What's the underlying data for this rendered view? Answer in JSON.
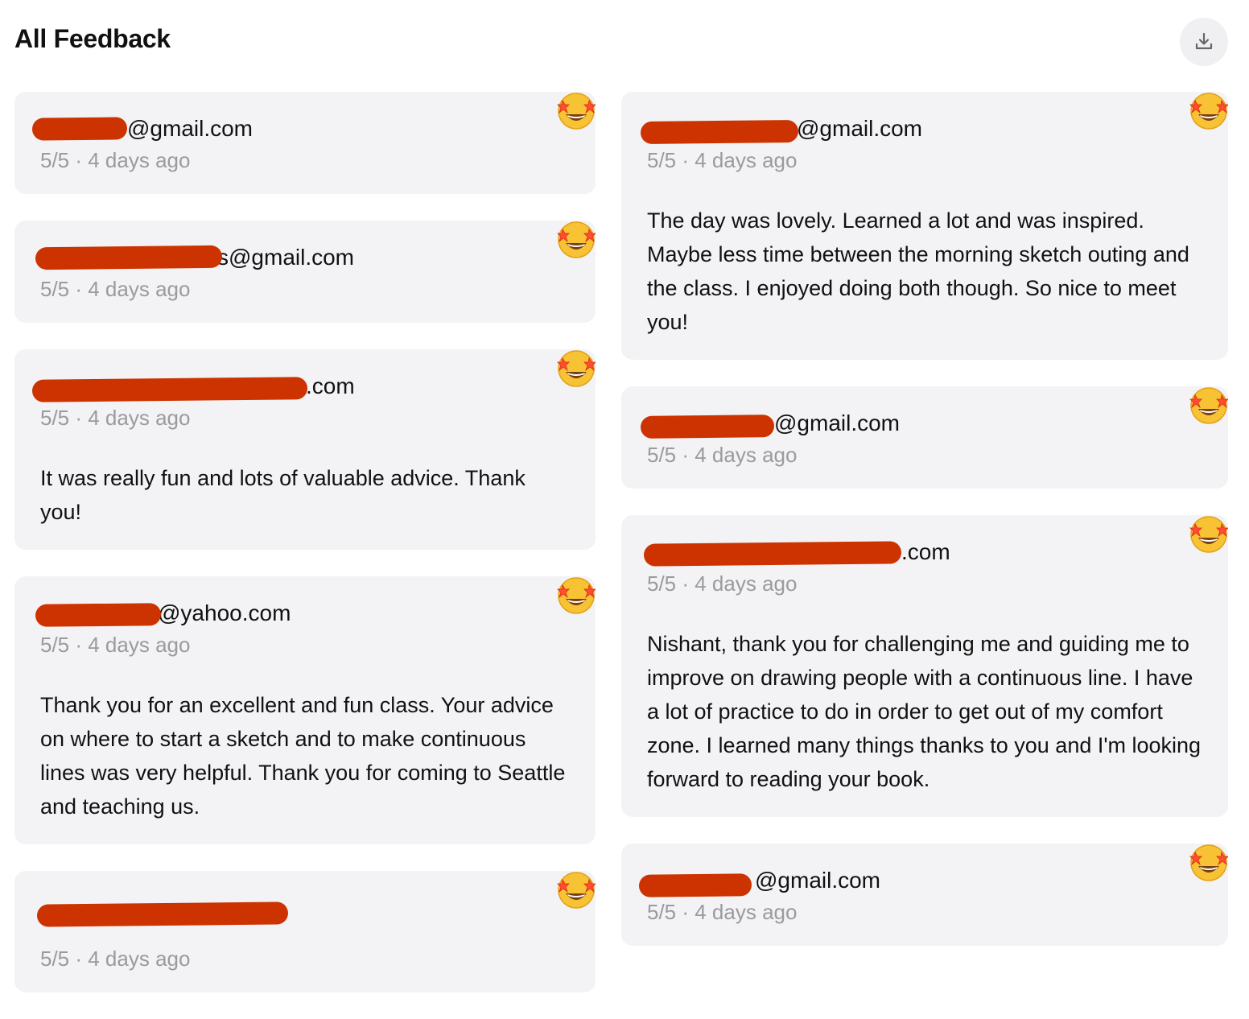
{
  "page": {
    "title": "All Feedback",
    "download_icon": "download-icon"
  },
  "colors": {
    "card_bg": "#f3f3f5",
    "redaction": "#cc3300",
    "meta_text": "#9a9a9f",
    "emoji_face": "#f7c234"
  },
  "left_cards": [
    {
      "email": "@gmail.com",
      "rating": "5/5",
      "time": "4 days ago",
      "meta": "5/5 · 4 days ago",
      "comment": "",
      "emoji_icon": "star-struck-emoji-icon"
    },
    {
      "email": "s@gmail.com",
      "rating": "5/5",
      "time": "4 days ago",
      "meta": "5/5 · 4 days ago",
      "comment": "",
      "emoji_icon": "star-struck-emoji-icon"
    },
    {
      "email": ".com",
      "rating": "5/5",
      "time": "4 days ago",
      "meta": "5/5 · 4 days ago",
      "comment": "It was really fun and lots of valuable advice. Thank you!",
      "emoji_icon": "star-struck-emoji-icon"
    },
    {
      "email": "@yahoo.com",
      "rating": "5/5",
      "time": "4 days ago",
      "meta": "5/5 · 4 days ago",
      "comment": "Thank you for an excellent and fun class. Your advice on where to start a sketch and to make continuous lines was very helpful. Thank you for coming to Seattle and teaching us.",
      "emoji_icon": "star-struck-emoji-icon"
    },
    {
      "email": "",
      "rating": "5/5",
      "time": "4 days ago",
      "meta": "5/5 · 4 days ago",
      "comment": "",
      "emoji_icon": "star-struck-emoji-icon"
    }
  ],
  "right_cards": [
    {
      "email": "@gmail.com",
      "rating": "5/5",
      "time": "4 days ago",
      "meta": "5/5 · 4 days ago",
      "comment": "The day was lovely. Learned a lot and was inspired. Maybe less time between the morning sketch outing and the class. I enjoyed doing both though. So nice to meet you!",
      "emoji_icon": "star-struck-emoji-icon"
    },
    {
      "email": "@gmail.com",
      "rating": "5/5",
      "time": "4 days ago",
      "meta": "5/5 · 4 days ago",
      "comment": "",
      "emoji_icon": "star-struck-emoji-icon"
    },
    {
      "email": ".com",
      "rating": "5/5",
      "time": "4 days ago",
      "meta": "5/5 · 4 days ago",
      "comment": "Nishant, thank you for challenging me and guiding me to improve on drawing people with a continuous line. I have a lot of practice to do in order to get out of my comfort zone. I learned many things thanks to you and I'm looking forward to reading your book.",
      "emoji_icon": "star-struck-emoji-icon"
    },
    {
      "email": "@gmail.com",
      "rating": "5/5",
      "time": "4 days ago",
      "meta": "5/5 · 4 days ago",
      "comment": "",
      "emoji_icon": "star-struck-emoji-icon"
    }
  ]
}
